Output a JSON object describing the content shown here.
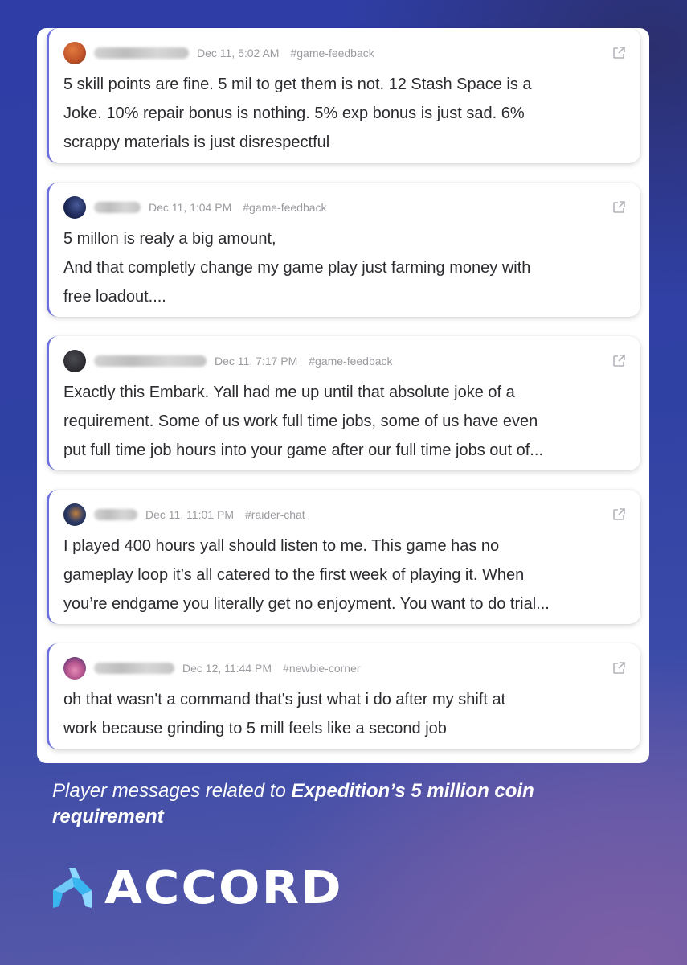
{
  "messages": [
    {
      "timestamp": "Dec 11, 5:02 AM",
      "channel": "#game-feedback",
      "avatar_color": "#c2552a",
      "lines": [
        "5 skill points are fine. 5 mil to get them is not. 12 Stash Space is a",
        "Joke. 10% repair bonus is nothing. 5% exp bonus is just sad. 6%",
        "scrappy materials is just disrespectful"
      ]
    },
    {
      "timestamp": "Dec 11, 1:04 PM",
      "channel": "#game-feedback",
      "avatar_color": "#1e2a5a",
      "lines": [
        "5 millon is realy a big amount,",
        "And that completly change my game play just farming money with",
        "free loadout...."
      ]
    },
    {
      "timestamp": "Dec 11, 7:17 PM",
      "channel": "#game-feedback",
      "avatar_color": "#2e2e33",
      "lines": [
        "Exactly this Embark. Yall had me up until that absolute joke of a",
        "requirement. Some of us work full time jobs, some of us have even",
        "put full time job hours into your game after our full time jobs out of..."
      ]
    },
    {
      "timestamp": "Dec 11, 11:01 PM",
      "channel": "#raider-chat",
      "avatar_color": "#2b3a66",
      "lines": [
        "I played 400 hours yall should listen to me. This game has no",
        "gameplay loop it’s all catered to the first week of playing it. When",
        "you’re endgame you literally get no enjoyment. You want to do trial..."
      ]
    },
    {
      "timestamp": "Dec 12, 11:44 PM",
      "channel": "#newbie-corner",
      "avatar_color": "#b7568f",
      "lines": [
        "oh that wasn't a command that's just what i do after my shift at",
        "work because grinding to 5 mill feels like a second job"
      ]
    }
  ],
  "caption": {
    "prefix": "Player messages related to ",
    "bold": "Expedition’s 5 million coin requirement"
  },
  "brand": {
    "name": "ACCORD",
    "accent": "#39b6f0",
    "accent_light": "#8fd8ff"
  }
}
